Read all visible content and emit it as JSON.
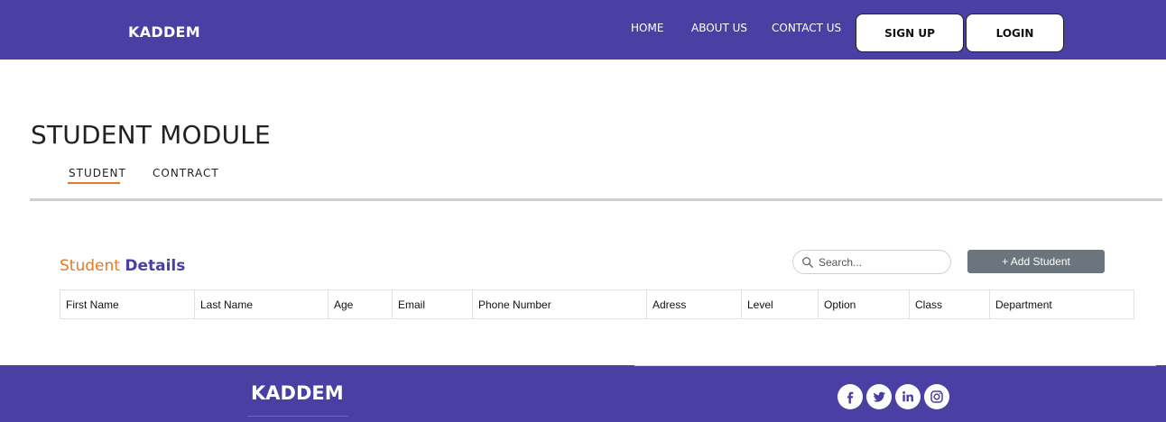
{
  "navbar": {
    "brand": "KADDEM",
    "links": [
      "HOME",
      "ABOUT US",
      "CONTACT US"
    ],
    "signup_label": "SIGN UP",
    "login_label": "LOGIN"
  },
  "module": {
    "title": "STUDENT MODULE",
    "tabs": [
      {
        "label": "STUDENT",
        "active": true
      },
      {
        "label": "CONTRACT",
        "active": false
      }
    ]
  },
  "details": {
    "title_part1": "Student",
    "title_part2": "Details",
    "search_placeholder": "Search...",
    "add_button_label": "+ Add Student",
    "columns": [
      "First Name",
      "Last Name",
      "Age",
      "Email",
      "Phone Number",
      "Adress",
      "Level",
      "Option",
      "Class",
      "Department"
    ]
  },
  "footer": {
    "brand": "KADDEM",
    "social_icons": [
      "facebook-icon",
      "twitter-icon",
      "linkedin-icon",
      "instagram-icon"
    ]
  },
  "colors": {
    "primary": "#4a3fa3",
    "accent": "#e8782a",
    "button_gray": "#6c757d"
  }
}
